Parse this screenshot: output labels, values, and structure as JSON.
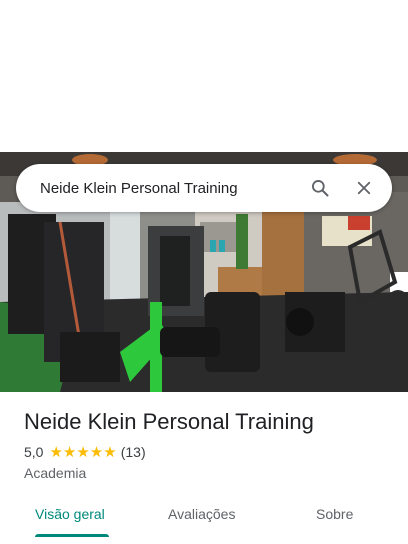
{
  "search": {
    "query": "Neide Klein Personal Training"
  },
  "icons": {
    "search": "search-icon",
    "close": "close-icon"
  },
  "place": {
    "name": "Neide Klein Personal Training",
    "rating": "5,0",
    "stars": "★★★★★",
    "reviews": "(13)",
    "category": "Academia"
  },
  "tabs": [
    {
      "label": "Visão geral",
      "active": true
    },
    {
      "label": "Avaliações",
      "active": false
    },
    {
      "label": "Sobre",
      "active": false
    }
  ],
  "colors": {
    "accent": "#00897b",
    "star": "#fbbc04",
    "equipment_green": "#2ec83c"
  }
}
